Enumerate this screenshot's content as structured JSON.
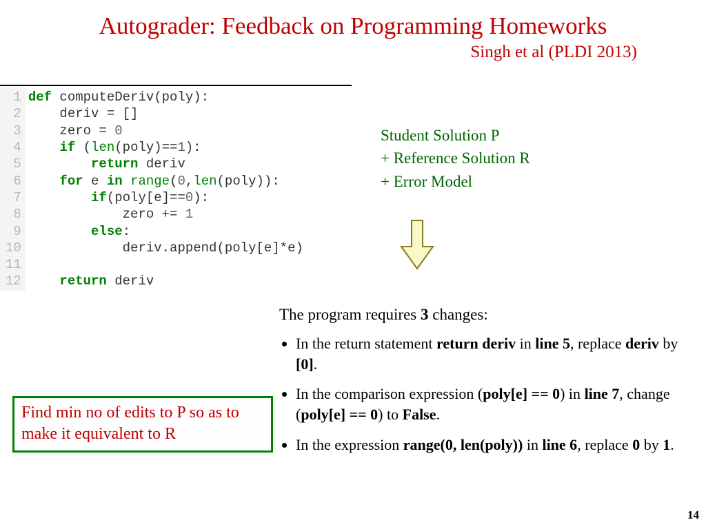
{
  "title": "Autograder: Feedback on Programming Homeworks",
  "subtitle": "Singh et al (PLDI 2013)",
  "code": {
    "linenos": " 1\n 2\n 3\n 4\n 5\n 6\n 7\n 8\n 9\n10\n11\n12",
    "lines": [
      {
        "tokens": [
          {
            "t": "def",
            "c": "kw"
          },
          {
            "t": " computeDeriv(poly):"
          }
        ]
      },
      {
        "tokens": [
          {
            "t": "    deriv = []"
          }
        ]
      },
      {
        "tokens": [
          {
            "t": "    zero = "
          },
          {
            "t": "0",
            "c": "num"
          }
        ]
      },
      {
        "tokens": [
          {
            "t": "    "
          },
          {
            "t": "if",
            "c": "kw"
          },
          {
            "t": " ("
          },
          {
            "t": "len",
            "c": "bi"
          },
          {
            "t": "(poly)=="
          },
          {
            "t": "1",
            "c": "num"
          },
          {
            "t": "):"
          }
        ]
      },
      {
        "tokens": [
          {
            "t": "        "
          },
          {
            "t": "return",
            "c": "kw"
          },
          {
            "t": " deriv"
          }
        ]
      },
      {
        "tokens": [
          {
            "t": "    "
          },
          {
            "t": "for",
            "c": "kw"
          },
          {
            "t": " e "
          },
          {
            "t": "in",
            "c": "kw"
          },
          {
            "t": " "
          },
          {
            "t": "range",
            "c": "bi"
          },
          {
            "t": "("
          },
          {
            "t": "0",
            "c": "num"
          },
          {
            "t": ","
          },
          {
            "t": "len",
            "c": "bi"
          },
          {
            "t": "(poly)):"
          }
        ]
      },
      {
        "tokens": [
          {
            "t": "        "
          },
          {
            "t": "if",
            "c": "kw"
          },
          {
            "t": "(poly[e]=="
          },
          {
            "t": "0",
            "c": "num"
          },
          {
            "t": "):"
          }
        ]
      },
      {
        "tokens": [
          {
            "t": "            zero += "
          },
          {
            "t": "1",
            "c": "num"
          }
        ]
      },
      {
        "tokens": [
          {
            "t": "        "
          },
          {
            "t": "else",
            "c": "kw"
          },
          {
            "t": ":"
          }
        ]
      },
      {
        "tokens": [
          {
            "t": "            deriv.append(poly[e]*e)"
          }
        ]
      },
      {
        "tokens": [
          {
            "t": ""
          }
        ]
      },
      {
        "tokens": [
          {
            "t": "    "
          },
          {
            "t": "return",
            "c": "kw"
          },
          {
            "t": " deriv"
          }
        ]
      }
    ]
  },
  "inputs": {
    "l1": "Student Solution P",
    "l2": "+ Reference Solution R",
    "l3": "+ Error Model"
  },
  "result_header_pre": "The program requires ",
  "result_header_num": "3",
  "result_header_post": " changes:",
  "bullets": [
    "In the return statement <b>return deriv</b> in <b>line 5</b>, replace <b>deriv</b> by <b>[0]</b>.",
    "In the comparison expression (<b>poly[e] == 0</b>) in <b>line 7</b>, change (<b>poly[e] == 0</b>) to <b>False</b>.",
    "In the expression <b>range(0, len(poly))</b> in <b>line 6</b>, replace <b>0</b> by <b>1</b>."
  ],
  "findbox": "Find min no of edits to P so as to make it equivalent to R",
  "pagenum": "14"
}
